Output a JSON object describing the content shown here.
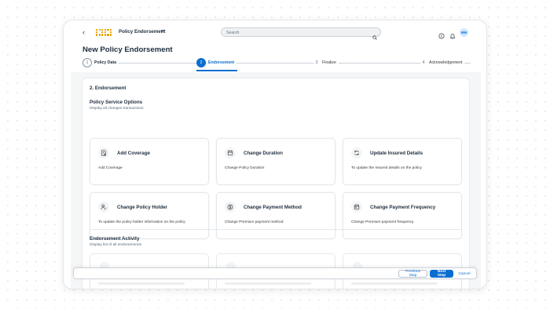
{
  "shell": {
    "back_glyph": "‹",
    "app_title": "Policy Endorsement",
    "search_placeholder": "Search",
    "avatar_initials": "MM"
  },
  "page": {
    "title": "New Policy Endorsement"
  },
  "steps": [
    {
      "number": "1",
      "label": "Policy Data",
      "state": "done"
    },
    {
      "number": "2",
      "label": "Endorsement",
      "state": "active"
    },
    {
      "number": "3",
      "label": "Finalize",
      "state": "upcoming"
    },
    {
      "number": "4",
      "label": "Acknowledgement",
      "state": "upcoming"
    }
  ],
  "section": {
    "title": "2. Endorsement",
    "options_title": "Policy Service Options",
    "options_subtitle": "Display all changes transactions",
    "activity_title": "Endorsement Activity",
    "activity_subtitle": "Display list of all endorsements"
  },
  "options": [
    {
      "title": "Add Coverage",
      "desc": "Add Coverage",
      "icon": "add-document-icon"
    },
    {
      "title": "Change Duration",
      "desc": "Change Policy Duration",
      "icon": "calendar-icon"
    },
    {
      "title": "Update Insured Details",
      "desc": "To update the Insured details on the policy",
      "icon": "refresh-icon"
    },
    {
      "title": "Change Policy Holder",
      "desc": "To update the policy holder information on the policy",
      "icon": "user-edit-icon"
    },
    {
      "title": "Change Payment Method",
      "desc": "Change Premium payment method",
      "icon": "money-icon"
    },
    {
      "title": "Change Payment Frequency",
      "desc": "Change Premium payment frequency",
      "icon": "calendar-frequency-icon"
    }
  ],
  "footer": {
    "previous": "Previous Step",
    "next": "Next Step",
    "cancel": "Cancel"
  },
  "colors": {
    "accent": "#0a6ed1",
    "logo": "#e9a200",
    "text": "#1d2d3e"
  }
}
